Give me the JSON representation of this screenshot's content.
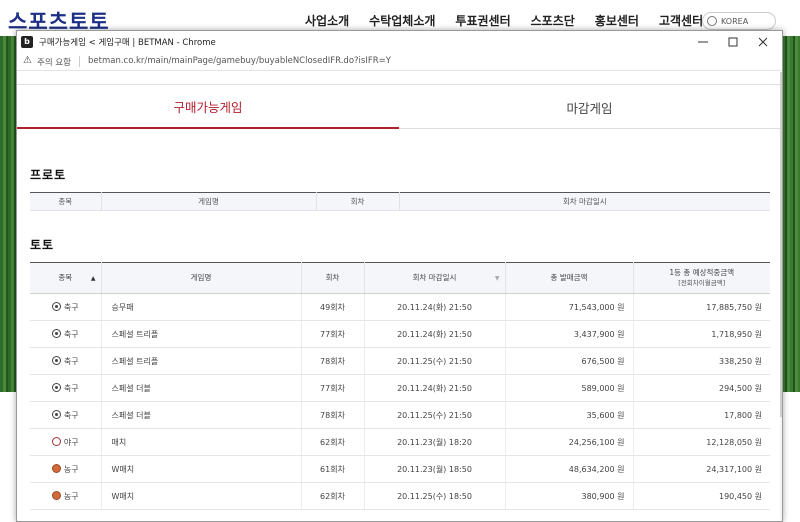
{
  "site": {
    "logo": "스포츠토토",
    "nav": [
      "사업소개",
      "수탁업체소개",
      "투표권센터",
      "스포츠단",
      "홍보센터",
      "고객센터"
    ],
    "lang": "KOREA"
  },
  "window": {
    "title": "구매가능게임 < 게임구매 | BETMAN - Chrome",
    "warning": "주의 요함",
    "url": "betman.co.kr/main/mainPage/gamebuy/buyableNClosedIFR.do?isIFR=Y"
  },
  "tabs": [
    {
      "label": "구매가능게임",
      "active": true
    },
    {
      "label": "마감게임",
      "active": false
    }
  ],
  "proto": {
    "title": "프로토",
    "headers": [
      "종목",
      "게임명",
      "회차",
      "회차 마감일시"
    ]
  },
  "toto": {
    "title": "토토",
    "headers": [
      "종목",
      "게임명",
      "회차",
      "회차 마감일시",
      "총 발매금액",
      "1등 총 예상적중금액",
      "[전회차이월금액]"
    ],
    "rows": [
      {
        "sport": "축구",
        "icon": "soccer-ball-icon",
        "game": "승무패",
        "round": "49회차",
        "deadline": "20.11.24(화) 21:50",
        "total": "71,543,000 원",
        "expected": "17,885,750 원"
      },
      {
        "sport": "축구",
        "icon": "soccer-ball-icon",
        "game": "스페셜 트리플",
        "round": "77회차",
        "deadline": "20.11.24(화) 21:50",
        "total": "3,437,900 원",
        "expected": "1,718,950 원"
      },
      {
        "sport": "축구",
        "icon": "soccer-ball-icon",
        "game": "스페셜 트리플",
        "round": "78회차",
        "deadline": "20.11.25(수) 21:50",
        "total": "676,500 원",
        "expected": "338,250 원"
      },
      {
        "sport": "축구",
        "icon": "soccer-ball-icon",
        "game": "스페셜 더블",
        "round": "77회차",
        "deadline": "20.11.24(화) 21:50",
        "total": "589,000 원",
        "expected": "294,500 원"
      },
      {
        "sport": "축구",
        "icon": "soccer-ball-icon",
        "game": "스페셜 더블",
        "round": "78회차",
        "deadline": "20.11.25(수) 21:50",
        "total": "35,600 원",
        "expected": "17,800 원"
      },
      {
        "sport": "야구",
        "icon": "baseball-icon",
        "game": "매치",
        "round": "62회차",
        "deadline": "20.11.23(월) 18:20",
        "total": "24,256,100 원",
        "expected": "12,128,050 원"
      },
      {
        "sport": "농구",
        "icon": "basketball-icon",
        "game": "W매치",
        "round": "61회차",
        "deadline": "20.11.23(월) 18:50",
        "total": "48,634,200 원",
        "expected": "24,317,100 원"
      },
      {
        "sport": "농구",
        "icon": "basketball-icon",
        "game": "W매치",
        "round": "62회차",
        "deadline": "20.11.25(수) 18:50",
        "total": "380,900 원",
        "expected": "190,450 원"
      }
    ]
  }
}
